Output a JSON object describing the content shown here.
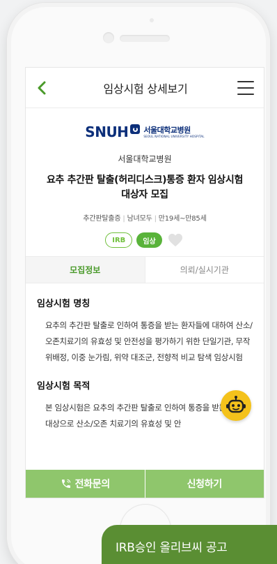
{
  "header": {
    "title": "임상시험 상세보기"
  },
  "hero": {
    "logo_en": "SNUH",
    "logo_ko": "서울대학교병원",
    "logo_sub": "SEOUL NATIONAL UNIVERSITY HOSPITAL",
    "hospital_name": "서울대학교병원",
    "study_title": "요추 추간판 탈출(허리디스크)통증 환자 임상시험 대상자 모집",
    "tags": [
      "추간판탈출증",
      "남녀모두",
      "만19세~만85세"
    ],
    "badge_irb": "IRB",
    "badge_phase": "임상"
  },
  "tabs": [
    {
      "label": "모집정보",
      "active": true
    },
    {
      "label": "의뢰/실시기관",
      "active": false
    }
  ],
  "sections": [
    {
      "title": "임상시험 명칭",
      "body": "요추의 추간판 탈출로 인하여 통증을 받는 환자들에 대하여 산소/오존치료기의 유효성 및 안전성을 평가하기 위한 단일기관, 무작위배정, 이중 눈가림, 위약 대조군, 전향적 비교 탐색 임상시험"
    },
    {
      "title": "임상시험 목적",
      "body": "본 임상시험은 요추의 추간판 탈출로 인하여 통증을 받는 환자를 대상으로 산소/오존 치료기의 유효성 및 안"
    }
  ],
  "bottom": {
    "call_label": "전화문의",
    "apply_label": "신청하기"
  },
  "promo": {
    "label": "IRB승인 올리브씨 공고"
  },
  "colors": {
    "accent_green": "#59b33a",
    "bottom_bar": "#8fc66c",
    "promo_bg": "#5a8e33",
    "bot_yellow": "#f4c21b",
    "logo_navy": "#0c2f7a"
  },
  "icons": {
    "back": "chevron-left-icon",
    "menu": "hamburger-menu-icon",
    "heart": "heart-icon",
    "phone": "phone-icon",
    "bot": "chatbot-icon"
  }
}
